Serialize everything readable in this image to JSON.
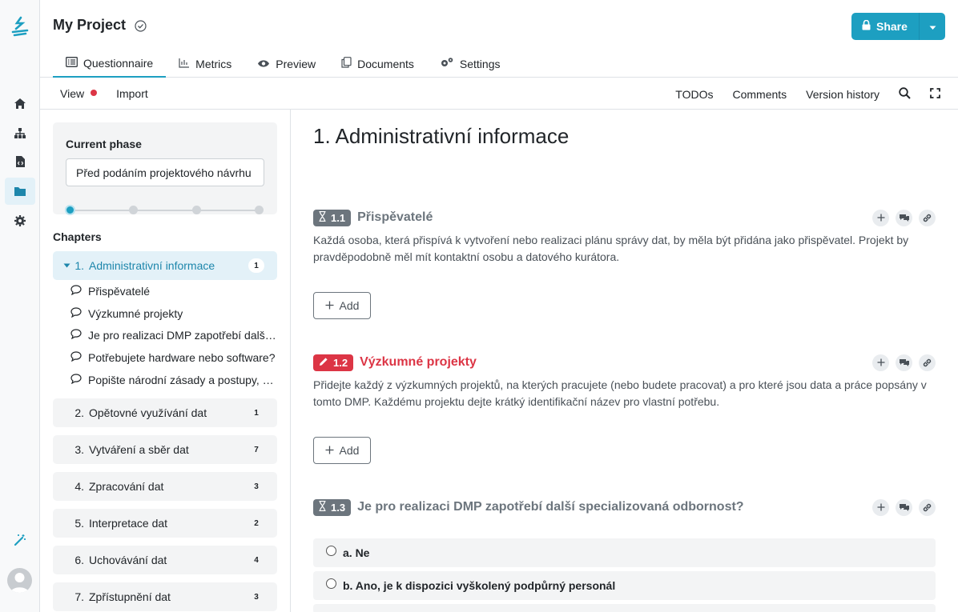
{
  "project": {
    "title": "My Project"
  },
  "share": {
    "label": "Share"
  },
  "tabs": [
    {
      "label": "Questionnaire",
      "icon": "list-icon"
    },
    {
      "label": "Metrics",
      "icon": "chart-icon"
    },
    {
      "label": "Preview",
      "icon": "eye-icon"
    },
    {
      "label": "Documents",
      "icon": "copy-icon"
    },
    {
      "label": "Settings",
      "icon": "cogs-icon"
    }
  ],
  "toolbar": {
    "view": "View",
    "import": "Import",
    "todos": "TODOs",
    "comments": "Comments",
    "version_history": "Version history"
  },
  "phase": {
    "label": "Current phase",
    "selected": "Před podáním projektového návrhu",
    "current_step": 1,
    "total_steps": 4
  },
  "chapters": {
    "label": "Chapters",
    "items": [
      {
        "num": "1.",
        "title": "Administrativní informace",
        "count": "1"
      },
      {
        "num": "2.",
        "title": "Opětovné využívání dat",
        "count": "1"
      },
      {
        "num": "3.",
        "title": "Vytváření a sběr dat",
        "count": "7"
      },
      {
        "num": "4.",
        "title": "Zpracování dat",
        "count": "3"
      },
      {
        "num": "5.",
        "title": "Interpretace dat",
        "count": "2"
      },
      {
        "num": "6.",
        "title": "Uchovávání dat",
        "count": "4"
      },
      {
        "num": "7.",
        "title": "Zpřístupnění dat",
        "count": "3"
      }
    ],
    "subitems": [
      "Přispěvatelé",
      "Výzkumné projekty",
      "Je pro realizaci DMP zapotřebí další specializovaná odbornost?",
      "Potřebujete hardware nebo software?",
      "Popište národní zásady a postupy, které"
    ]
  },
  "content": {
    "chapter_title": "1. Administrativní informace",
    "questions": [
      {
        "num": "1.1",
        "title": "Přispěvatelé",
        "desc": "Každá osoba, která přispívá k vytvoření nebo realizaci plánu správy dat, by měla být přidána jako přispěvatel. Projekt by pravděpodobně měl mít kontaktní osobu a datového kurátora.",
        "add": "Add"
      },
      {
        "num": "1.2",
        "title": "Výzkumné projekty",
        "desc": "Přidejte každý z výzkumných projektů, na kterých pracujete (nebo budete pracovat) a pro které jsou data a práce popsány v tomto DMP. Každému projektu dejte krátký identifikační název pro vlastní potřebu.",
        "add": "Add"
      },
      {
        "num": "1.3",
        "title": "Je pro realizaci DMP zapotřebí další specializovaná odbornost?",
        "options": [
          "a. Ne",
          "b. Ano, je k dispozici vyškolený podpůrný personál"
        ]
      }
    ]
  },
  "colors": {
    "accent": "#1d9fc1",
    "danger": "#dc3545",
    "muted": "#6c757d"
  }
}
